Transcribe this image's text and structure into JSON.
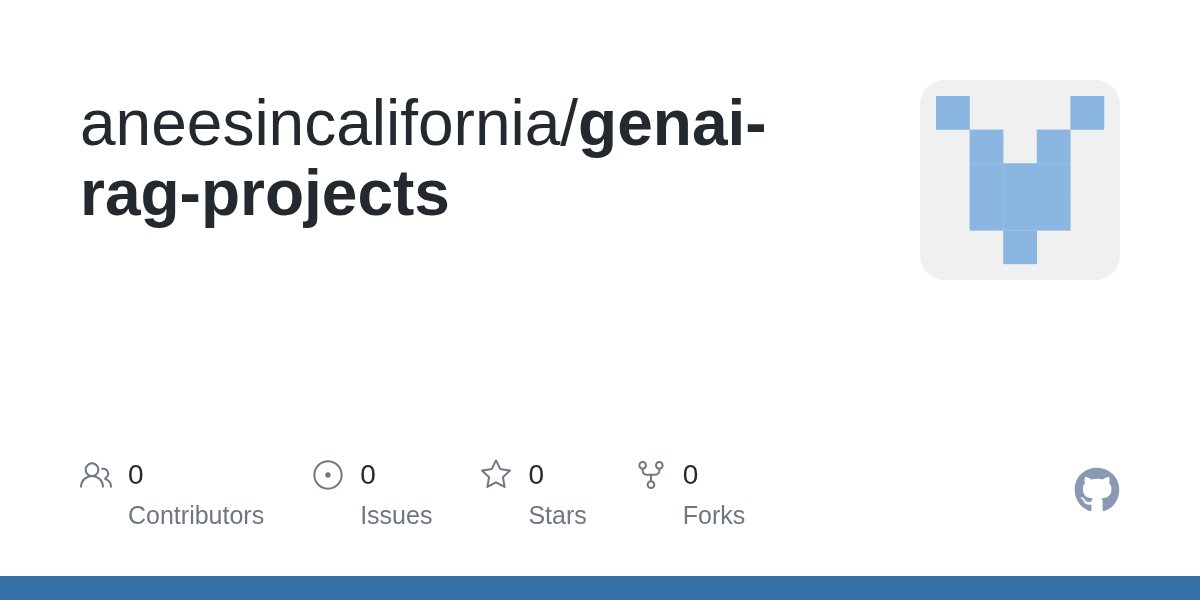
{
  "repo": {
    "title": "aneesincalifornia/**genai-rag-projects**"
  },
  "stats": [
    {
      "kind": "contributors",
      "count": "0",
      "label": "Contributors"
    },
    {
      "kind": "issues",
      "count": "0",
      "label": "Issues"
    },
    {
      "kind": "stars",
      "count": "0",
      "label": "Stars"
    },
    {
      "kind": "forks",
      "count": "0",
      "label": "Forks"
    }
  ],
  "language_bar": [
    {
      "color": "#3572a5"
    }
  ]
}
